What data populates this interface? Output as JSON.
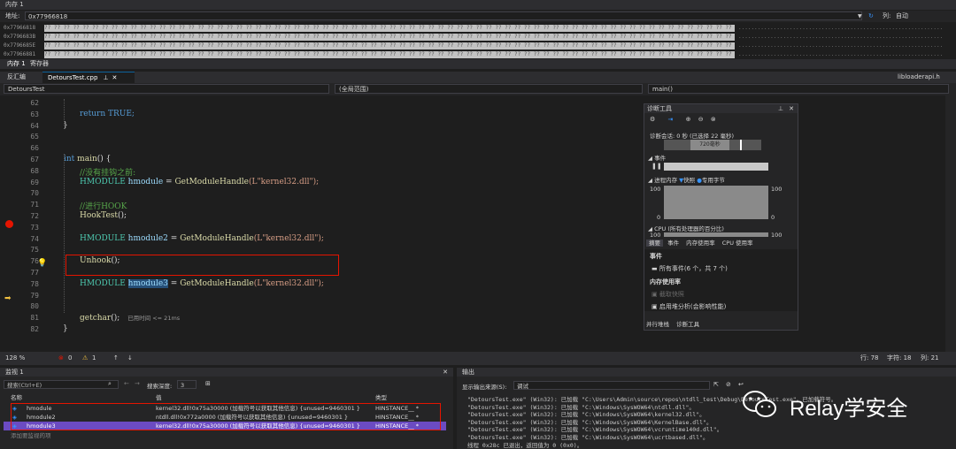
{
  "memory": {
    "title": "内存 1",
    "address_label": "地址:",
    "address_value": "0x77966818",
    "columns_label": "列:",
    "columns_value": "自动",
    "rows": [
      {
        "addr": "0x77966818",
        "bytes": "?? ?? ?? ?? ?? ?? ?? ?? ?? ?? ?? ?? ?? ?? ?? ?? ?? ?? ?? ?? ?? ?? ?? ?? ?? ?? ?? ?? ?? ?? ?? ?? ?? ?? ?? ?? ?? ?? ?? ?? ?? ?? ?? ?? ?? ?? ?? ?? ?? ?? ?? ?? ?? ?? ?? ?? ?? ?? ?? ?? ?? ?? ?? ?? ?? ?? ?? ?? ?? ?? ?? ?? ?? ?? ?? ?? ?? ?? ?? ?? ?? ??",
        "ascii": "................................................................"
      },
      {
        "addr": "0x7796683B",
        "bytes": "?? ?? ?? ?? ?? ?? ?? ?? ?? ?? ?? ?? ?? ?? ?? ?? ?? ?? ?? ?? ?? ?? ?? ?? ?? ?? ?? ?? ?? ?? ?? ?? ?? ?? ?? ?? ?? ?? ?? ?? ?? ?? ?? ?? ?? ?? ?? ?? ?? ?? ?? ?? ?? ?? ?? ?? ?? ?? ?? ?? ?? ?? ?? ?? ?? ?? ?? ?? ?? ?? ?? ?? ?? ?? ?? ?? ?? ?? ?? ?? ?? ??",
        "ascii": "................................................................"
      },
      {
        "addr": "0x7796685E",
        "bytes": "?? ?? ?? ?? ?? ?? ?? ?? ?? ?? ?? ?? ?? ?? ?? ?? ?? ?? ?? ?? ?? ?? ?? ?? ?? ?? ?? ?? ?? ?? ?? ?? ?? ?? ?? ?? ?? ?? ?? ?? ?? ?? ?? ?? ?? ?? ?? ?? ?? ?? ?? ?? ?? ?? ?? ?? ?? ?? ?? ?? ?? ?? ?? ?? ?? ?? ?? ?? ?? ?? ?? ?? ?? ?? ?? ?? ?? ?? ?? ?? ?? ??",
        "ascii": "................................................................"
      },
      {
        "addr": "0x77966881",
        "bytes": "?? ?? ?? ?? ?? ?? ?? ?? ?? ?? ?? ?? ?? ?? ?? ?? ?? ?? ?? ?? ?? ?? ?? ?? ?? ?? ?? ?? ?? ?? ?? ?? ?? ?? ?? ?? ?? ?? ?? ?? ?? ?? ?? ?? ?? ?? ?? ?? ?? ?? ?? ?? ?? ?? ?? ?? ?? ?? ?? ?? ?? ?? ?? ?? ?? ?? ?? ?? ?? ?? ?? ?? ?? ?? ?? ?? ?? ?? ?? ?? ?? ??",
        "ascii": "................................................................"
      }
    ],
    "tabs": [
      "内存 1",
      "寄存器"
    ]
  },
  "doc_tabs": {
    "disasm": "反汇编",
    "file": "DetoursTest.cpp",
    "right": "libloaderapi.h"
  },
  "nav": {
    "project": "DetoursTest",
    "scope": "(全局范围)",
    "func": "main()"
  },
  "code": {
    "lines": [
      {
        "n": "62",
        "text": ""
      },
      {
        "n": "63",
        "text": "return TRUE;"
      },
      {
        "n": "64",
        "text": "}"
      },
      {
        "n": "65",
        "text": ""
      },
      {
        "n": "66",
        "text": ""
      },
      {
        "n": "67",
        "kw": "int",
        "fn": "main",
        "rest": "() {"
      },
      {
        "n": "68",
        "comment": "//没有挂钩之前:"
      },
      {
        "n": "69",
        "type": "HMODULE",
        "var": "hmodule",
        "eq": " = ",
        "call": "GetModuleHandle",
        "arg": "(L\"kernel32.dll\");"
      },
      {
        "n": "70",
        "text": ""
      },
      {
        "n": "71",
        "comment": "//进行HOOK"
      },
      {
        "n": "72",
        "call": "HookTest",
        "arg": "();"
      },
      {
        "n": "73",
        "text": ""
      },
      {
        "n": "74",
        "type": "HMODULE",
        "var": "hmodule2",
        "eq": " = ",
        "call": "GetModuleHandle",
        "arg": "(L\"kernel32.dll\");"
      },
      {
        "n": "75",
        "text": ""
      },
      {
        "n": "76",
        "call": "Unhook",
        "arg": "();"
      },
      {
        "n": "77",
        "text": ""
      },
      {
        "n": "78",
        "type": "HMODULE",
        "var": "hmodule3",
        "eq": " = ",
        "call": "GetModuleHandle",
        "arg": "(L\"kernel32.dll\");"
      },
      {
        "n": "79",
        "text": ""
      },
      {
        "n": "80",
        "text": ""
      },
      {
        "n": "81",
        "call": "getchar",
        "arg": "();",
        "hint": "已用时间 <= 21ms"
      },
      {
        "n": "82",
        "text": "}"
      }
    ]
  },
  "diag": {
    "title": "诊断工具",
    "session": "诊断会话: 0 秒 (已选择 22 毫秒)",
    "time_label": "720毫秒",
    "events_label": "事件",
    "memory_label": "进程内存",
    "snapshot": "快照",
    "private": "专用字节",
    "axis_top": "100",
    "axis_bottom": "0",
    "cpu_label": "CPU (所有处理器的百分比)",
    "cpu_axis": "100",
    "tabs": [
      "摘要",
      "事件",
      "内存使用率",
      "CPU 使用率"
    ],
    "events_section": "事件",
    "all_events": "所有事件(6 个，共 7 个)",
    "mem_section": "内存使用率",
    "take_snapshot": "截取快照",
    "heap_analysis": "启用堆分析(会影响性能)",
    "bottom_tabs": [
      "并行堆栈",
      "诊断工具"
    ]
  },
  "status": {
    "zoom": "128 %",
    "errors": "0",
    "warnings": "1",
    "row": "行: 78",
    "char": "字符: 18",
    "col": "列: 21"
  },
  "watch": {
    "title": "监视 1",
    "search_placeholder": "搜索(Ctrl+E)",
    "depth_label": "搜索深度:",
    "depth_value": "3",
    "col_name": "名称",
    "col_value": "值",
    "col_type": "类型",
    "rows": [
      {
        "name": "hmodule",
        "value": "kernel32.dll!0x75a30000 (加载符号以获取其他信息) {unused=9460301 }",
        "type": "HINSTANCE__ *"
      },
      {
        "name": "hmodule2",
        "value": "ntdll.dll!0x772a0000 (加载符号以获取其他信息) {unused=9460301 }",
        "type": "HINSTANCE__ *"
      },
      {
        "name": "hmodule3",
        "value": "kernel32.dll!0x75a30000 (加载符号以获取其他信息) {unused=9460301 }",
        "type": "HINSTANCE__ *"
      }
    ],
    "add_item": "添加要监视的项"
  },
  "output": {
    "title": "输出",
    "source_label": "显示输出来源(S):",
    "source_value": "调试",
    "lines": [
      "\"DetoursTest.exe\" (Win32): 已加载 \"C:\\Users\\Admin\\source\\repos\\ntdll_test\\Debug\\DetoursTest.exe\"。已加载符号。",
      "\"DetoursTest.exe\" (Win32): 已加载 \"C:\\Windows\\SysWOW64\\ntdll.dll\"。",
      "\"DetoursTest.exe\" (Win32): 已加载 \"C:\\Windows\\SysWOW64\\kernel32.dll\"。",
      "\"DetoursTest.exe\" (Win32): 已加载 \"C:\\Windows\\SysWOW64\\KernelBase.dll\"。",
      "\"DetoursTest.exe\" (Win32): 已加载 \"C:\\Windows\\SysWOW64\\vcruntime140d.dll\"。",
      "\"DetoursTest.exe\" (Win32): 已加载 \"C:\\Windows\\SysWOW64\\ucrtbased.dll\"。",
      "线程 0x28c 已退出，返回值为 0 (0x0)。"
    ]
  },
  "watermark": "Relay学安全",
  "colors": {
    "accent": "#0e639c",
    "breakpoint": "#e51400",
    "selection": "#6b4bc2"
  }
}
